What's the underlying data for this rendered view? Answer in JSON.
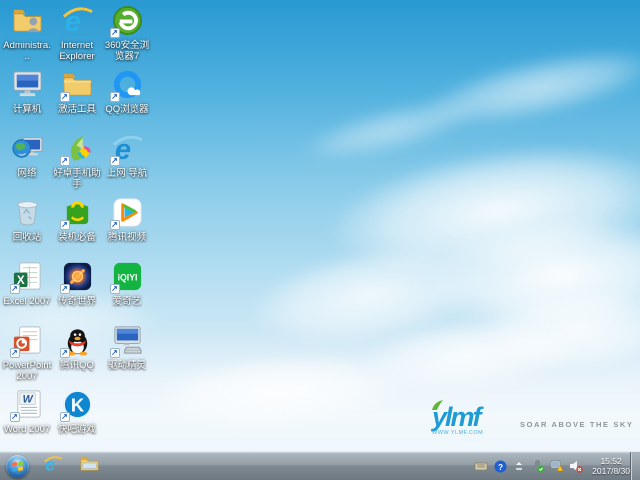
{
  "desktop": {
    "icons": [
      {
        "label": "Administra...",
        "has_shortcut_arrow": false
      },
      {
        "label": "Internet Explorer",
        "has_shortcut_arrow": false
      },
      {
        "label": "360安全浏览器7",
        "has_shortcut_arrow": true
      },
      {
        "label": "计算机",
        "has_shortcut_arrow": false
      },
      {
        "label": "激活工具",
        "has_shortcut_arrow": true
      },
      {
        "label": "QQ浏览器",
        "has_shortcut_arrow": true
      },
      {
        "label": "网络",
        "has_shortcut_arrow": false
      },
      {
        "label": "好卓手机助手",
        "has_shortcut_arrow": true
      },
      {
        "label": "上网 导航",
        "has_shortcut_arrow": true
      },
      {
        "label": "回收站",
        "has_shortcut_arrow": false
      },
      {
        "label": "装机必备",
        "has_shortcut_arrow": true
      },
      {
        "label": "腾讯视频",
        "has_shortcut_arrow": true
      },
      {
        "label": "Excel 2007",
        "has_shortcut_arrow": true
      },
      {
        "label": "传奇世界",
        "has_shortcut_arrow": true
      },
      {
        "label": "爱奇艺",
        "has_shortcut_arrow": true
      },
      {
        "label": "PowerPoint 2007",
        "has_shortcut_arrow": true
      },
      {
        "label": "腾讯QQ",
        "has_shortcut_arrow": true
      },
      {
        "label": "驱动精灵",
        "has_shortcut_arrow": true
      },
      {
        "label": "Word 2007",
        "has_shortcut_arrow": true
      },
      {
        "label": "快吧游戏",
        "has_shortcut_arrow": true
      }
    ]
  },
  "watermark": {
    "logo_text": "ylmf",
    "tagline": "SOAR ABOVE THE SKY",
    "url": "WWW.YLMF.COM"
  },
  "taskbar": {
    "tray_icons": [
      "input-indicator",
      "help",
      "show-hidden-icons",
      "device-ok",
      "network-warning",
      "volume-muted"
    ],
    "clock": {
      "time": "15:52",
      "date": "2017/8/30"
    }
  },
  "colors": {
    "sky_top": "#2899d2",
    "sky_bottom": "#eaf5fb",
    "taskbar": "#8c97a0",
    "label_text": "#ffffff",
    "watermark_blue": "#1f9cd6",
    "iqiyi_green": "#12b442"
  },
  "iqiyi_logo_text": "iQIYI",
  "office_letters": {
    "excel": "X",
    "word": "W"
  }
}
